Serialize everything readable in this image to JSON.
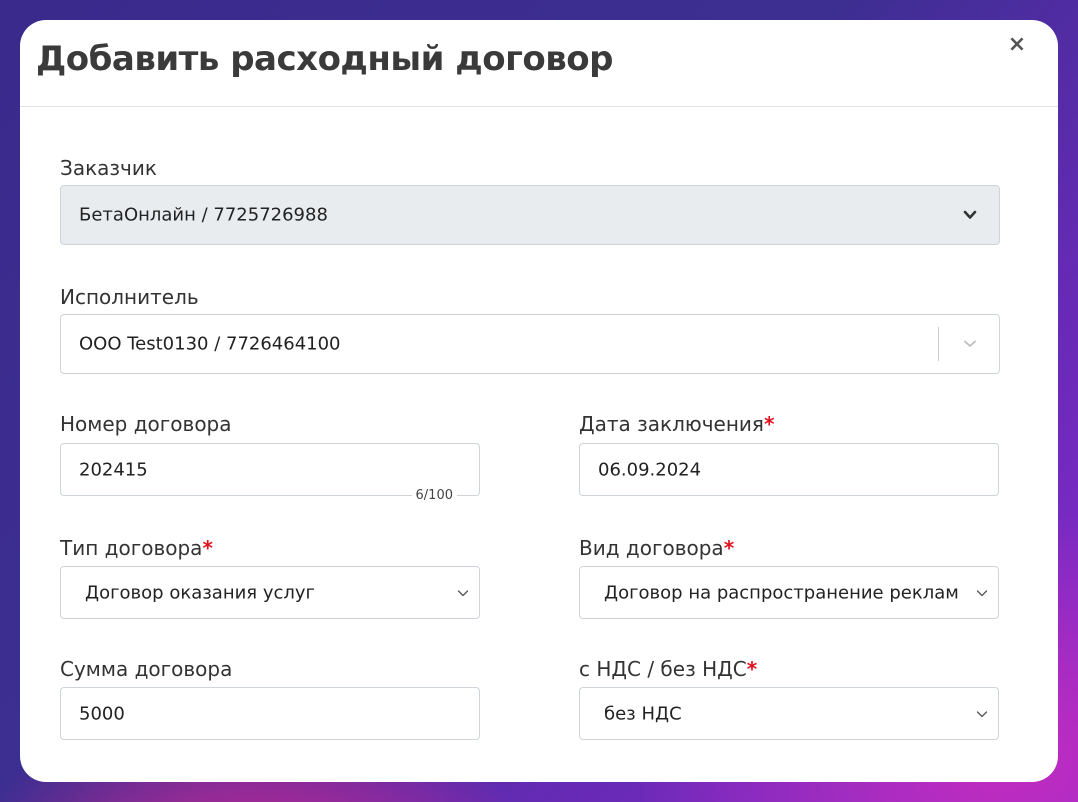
{
  "modal": {
    "title": "Добавить расходный договор",
    "close_glyph": "×"
  },
  "customer": {
    "label": "Заказчик",
    "value": "БетаОнлайн / 7725726988"
  },
  "contractor": {
    "label": "Исполнитель",
    "value": "ООО Test0130 / 7726464100"
  },
  "contract_number": {
    "label": "Номер договора",
    "value": "202415",
    "counter": "6/100"
  },
  "contract_date": {
    "label": "Дата заключения",
    "required_mark": "*",
    "value": "06.09.2024"
  },
  "contract_type": {
    "label": "Тип договора",
    "required_mark": "*",
    "value": "Договор оказания услуг"
  },
  "contract_kind": {
    "label": "Вид договора",
    "required_mark": "*",
    "value": "Договор на распространение рекламы"
  },
  "contract_sum": {
    "label": "Сумма договора",
    "value": "5000"
  },
  "vat": {
    "label": "с НДС / без НДС",
    "required_mark": "*",
    "value": "без НДС"
  },
  "colors": {
    "required": "#e0101f",
    "border": "#ced4da",
    "disabled_bg": "#e9ecef"
  },
  "icons": [
    "close-icon",
    "chevron-down-icon"
  ]
}
